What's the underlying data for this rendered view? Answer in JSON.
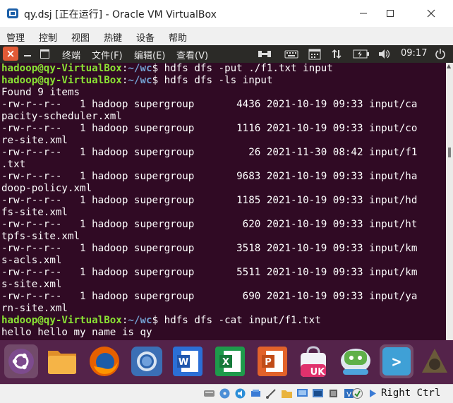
{
  "window": {
    "title": "qy.dsj [正在运行] - Oracle VM VirtualBox",
    "menu": [
      "管理",
      "控制",
      "视图",
      "热键",
      "设备",
      "帮助"
    ]
  },
  "guest_panel": {
    "menu": [
      "终端",
      "文件(F)",
      "编辑(E)",
      "查看(V)"
    ],
    "clock": "09:17"
  },
  "terminal": {
    "prompt_user": "hadoop@qy-VirtualBox",
    "prompt_sep": ":",
    "prompt_path": "~/wc",
    "prompt_end": "$ ",
    "lines": [
      {
        "type": "prompt",
        "cmd": "hdfs dfs -put ./f1.txt input"
      },
      {
        "type": "prompt",
        "cmd": "hdfs dfs -ls input"
      },
      {
        "type": "out",
        "text": "Found 9 items"
      },
      {
        "type": "out",
        "text": "-rw-r--r--   1 hadoop supergroup       4436 2021-10-19 09:33 input/ca"
      },
      {
        "type": "out",
        "text": "pacity-scheduler.xml"
      },
      {
        "type": "out",
        "text": "-rw-r--r--   1 hadoop supergroup       1116 2021-10-19 09:33 input/co"
      },
      {
        "type": "out",
        "text": "re-site.xml"
      },
      {
        "type": "out",
        "text": "-rw-r--r--   1 hadoop supergroup         26 2021-11-30 08:42 input/f1"
      },
      {
        "type": "out",
        "text": ".txt"
      },
      {
        "type": "out",
        "text": "-rw-r--r--   1 hadoop supergroup       9683 2021-10-19 09:33 input/ha"
      },
      {
        "type": "out",
        "text": "doop-policy.xml"
      },
      {
        "type": "out",
        "text": "-rw-r--r--   1 hadoop supergroup       1185 2021-10-19 09:33 input/hd"
      },
      {
        "type": "out",
        "text": "fs-site.xml"
      },
      {
        "type": "out",
        "text": "-rw-r--r--   1 hadoop supergroup        620 2021-10-19 09:33 input/ht"
      },
      {
        "type": "out",
        "text": "tpfs-site.xml"
      },
      {
        "type": "out",
        "text": "-rw-r--r--   1 hadoop supergroup       3518 2021-10-19 09:33 input/km"
      },
      {
        "type": "out",
        "text": "s-acls.xml"
      },
      {
        "type": "out",
        "text": "-rw-r--r--   1 hadoop supergroup       5511 2021-10-19 09:33 input/km"
      },
      {
        "type": "out",
        "text": "s-site.xml"
      },
      {
        "type": "out",
        "text": "-rw-r--r--   1 hadoop supergroup        690 2021-10-19 09:33 input/ya"
      },
      {
        "type": "out",
        "text": "rn-site.xml"
      },
      {
        "type": "prompt",
        "cmd": "hdfs dfs -cat input/f1.txt"
      },
      {
        "type": "out",
        "text": "hello hello my name is qy"
      }
    ]
  },
  "dock": {
    "items": [
      {
        "name": "ubuntu-logo-icon",
        "label": ""
      },
      {
        "name": "files-icon",
        "label": ""
      },
      {
        "name": "firefox-icon",
        "label": ""
      },
      {
        "name": "chromium-icon",
        "label": ""
      },
      {
        "name": "wps-writer-icon",
        "label": "W"
      },
      {
        "name": "wps-spreadsheet-icon",
        "label": "X"
      },
      {
        "name": "wps-presentation-icon",
        "label": "P"
      },
      {
        "name": "ubuntu-kylin-software-icon",
        "label": "UK"
      },
      {
        "name": "youker-assistant-icon",
        "label": ""
      },
      {
        "name": "terminal-icon",
        "label": ">"
      }
    ]
  },
  "statusbar": {
    "host_key": "Right Ctrl"
  },
  "colors": {
    "terminal_bg": "#300a24",
    "prompt_user": "#8ae234",
    "prompt_path": "#729fcf",
    "dock_bg": "#54234a",
    "guest_close": "#e15a36"
  }
}
